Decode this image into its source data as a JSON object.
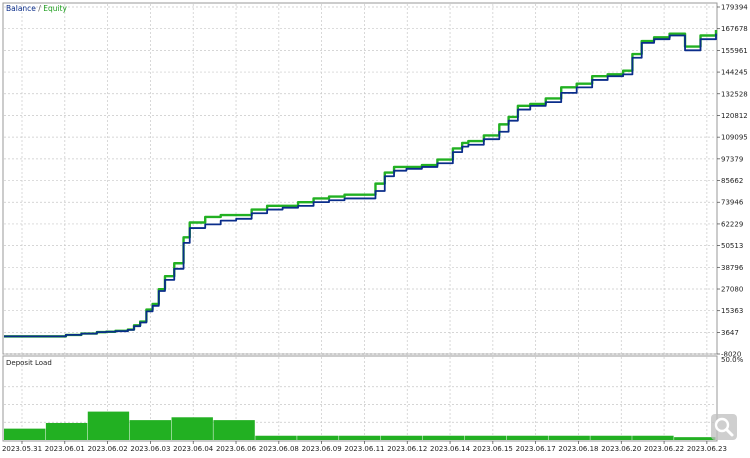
{
  "legend": {
    "balance": "Balance",
    "separator": " / ",
    "equity": "Equity"
  },
  "colors": {
    "balance": "#0a2d8a",
    "equity": "#22b022",
    "deposit_load": "#22b022",
    "grid": "#c8c8c8",
    "axis": "#444444"
  },
  "chart_data": [
    {
      "type": "line",
      "title": "",
      "legend": [
        "Balance",
        "Equity"
      ],
      "ylim": [
        -8020,
        179394
      ],
      "yticks": [
        179394,
        167678,
        155961,
        144245,
        132528,
        120812,
        109095,
        97379,
        85662,
        73946,
        62229,
        50513,
        38796,
        27080,
        15363,
        3647,
        -8020
      ],
      "ytick_labels": [
        "179394",
        "167678",
        "155961",
        "144245",
        "132528",
        "120812",
        "109095",
        "97379",
        "85662",
        "73946",
        "62229",
        "50513",
        "38796",
        "27080",
        "15363",
        "3647",
        "-8020"
      ],
      "xlim": [
        0,
        23
      ],
      "grid": true,
      "series": [
        {
          "name": "Balance",
          "x": [
            0,
            1,
            2,
            2.5,
            3,
            3.3,
            3.6,
            4.0,
            4.2,
            4.4,
            4.6,
            4.8,
            5.0,
            5.2,
            5.5,
            5.8,
            6.0,
            6.5,
            7.0,
            7.5,
            8.0,
            8.5,
            9.0,
            9.5,
            10.0,
            10.5,
            11.0,
            11.5,
            12.0,
            12.3,
            12.6,
            13.0,
            13.5,
            14.0,
            14.5,
            14.8,
            15.0,
            15.5,
            16.0,
            16.3,
            16.6,
            17.0,
            17.5,
            18.0,
            18.5,
            19.0,
            19.5,
            20.0,
            20.3,
            20.6,
            21.0,
            21.5,
            22.0,
            22.5,
            23.0
          ],
          "values": [
            1500,
            1500,
            2300,
            3000,
            3800,
            4000,
            4300,
            5000,
            7000,
            9000,
            15000,
            18000,
            26000,
            32000,
            38000,
            52000,
            60000,
            62000,
            64000,
            65000,
            68000,
            70000,
            71000,
            72000,
            74000,
            75000,
            76000,
            76000,
            80000,
            88000,
            91000,
            92000,
            93000,
            95000,
            101000,
            104000,
            105000,
            108000,
            112000,
            118000,
            124000,
            126000,
            128000,
            133000,
            136000,
            140000,
            142000,
            143000,
            152000,
            160000,
            162000,
            164000,
            156000,
            162000,
            165000
          ]
        },
        {
          "name": "Equity",
          "x": [
            0,
            1,
            2,
            2.5,
            3,
            3.3,
            3.6,
            4.0,
            4.2,
            4.4,
            4.6,
            4.8,
            5.0,
            5.2,
            5.5,
            5.8,
            6.0,
            6.5,
            7.0,
            7.5,
            8.0,
            8.5,
            9.0,
            9.5,
            10.0,
            10.5,
            11.0,
            11.5,
            12.0,
            12.3,
            12.6,
            13.0,
            13.5,
            14.0,
            14.5,
            14.8,
            15.0,
            15.5,
            16.0,
            16.3,
            16.6,
            17.0,
            17.5,
            18.0,
            18.5,
            19.0,
            19.5,
            20.0,
            20.3,
            20.6,
            21.0,
            21.5,
            22.0,
            22.5,
            23.0
          ],
          "values": [
            1500,
            1500,
            2300,
            3000,
            3800,
            4000,
            4500,
            5200,
            7500,
            9500,
            16000,
            19000,
            27000,
            34000,
            41000,
            55000,
            63000,
            66000,
            67000,
            67000,
            70000,
            72000,
            72000,
            74000,
            76000,
            77000,
            78000,
            78000,
            84000,
            90000,
            93000,
            93000,
            94000,
            97000,
            103000,
            106000,
            107000,
            110000,
            116000,
            120000,
            126000,
            127000,
            130000,
            136000,
            138000,
            142000,
            143000,
            145000,
            154000,
            161000,
            163000,
            165000,
            158000,
            164000,
            167000
          ]
        }
      ]
    },
    {
      "type": "bar",
      "title": "Deposit Load",
      "ylim": [
        0,
        50
      ],
      "ytick_labels": [
        "50.0%"
      ],
      "categories": [
        "2023.05.31",
        "2023.06.01",
        "2023.06.02",
        "2023.06.03",
        "2023.06.04",
        "2023.06.06",
        "2023.06.08",
        "2023.06.09",
        "2023.06.11",
        "2023.06.12",
        "2023.06.14",
        "2023.06.15",
        "2023.06.17",
        "2023.06.18",
        "2023.06.20",
        "2023.06.22",
        "2023.06.23"
      ],
      "values": [
        8,
        12,
        20,
        14,
        16,
        14,
        3,
        3,
        3,
        3,
        3,
        3,
        3,
        3,
        3,
        3,
        2
      ],
      "series": [
        {
          "name": "",
          "values": [
            8,
            12,
            20,
            14,
            16,
            14,
            3,
            3,
            3,
            3,
            3,
            3,
            3,
            3,
            3,
            3,
            2
          ]
        }
      ]
    }
  ],
  "x_axis": {
    "labels": [
      "2023.05.31",
      "2023.06.01",
      "2023.06.02",
      "2023.06.03",
      "2023.06.04",
      "2023.06.06",
      "2023.06.08",
      "2023.06.09",
      "2023.06.11",
      "2023.06.12",
      "2023.06.14",
      "2023.06.15",
      "2023.06.17",
      "2023.06.18",
      "2023.06.20",
      "2023.06.22",
      "2023.06.23"
    ]
  },
  "watermark_icon": "zoom-icon"
}
